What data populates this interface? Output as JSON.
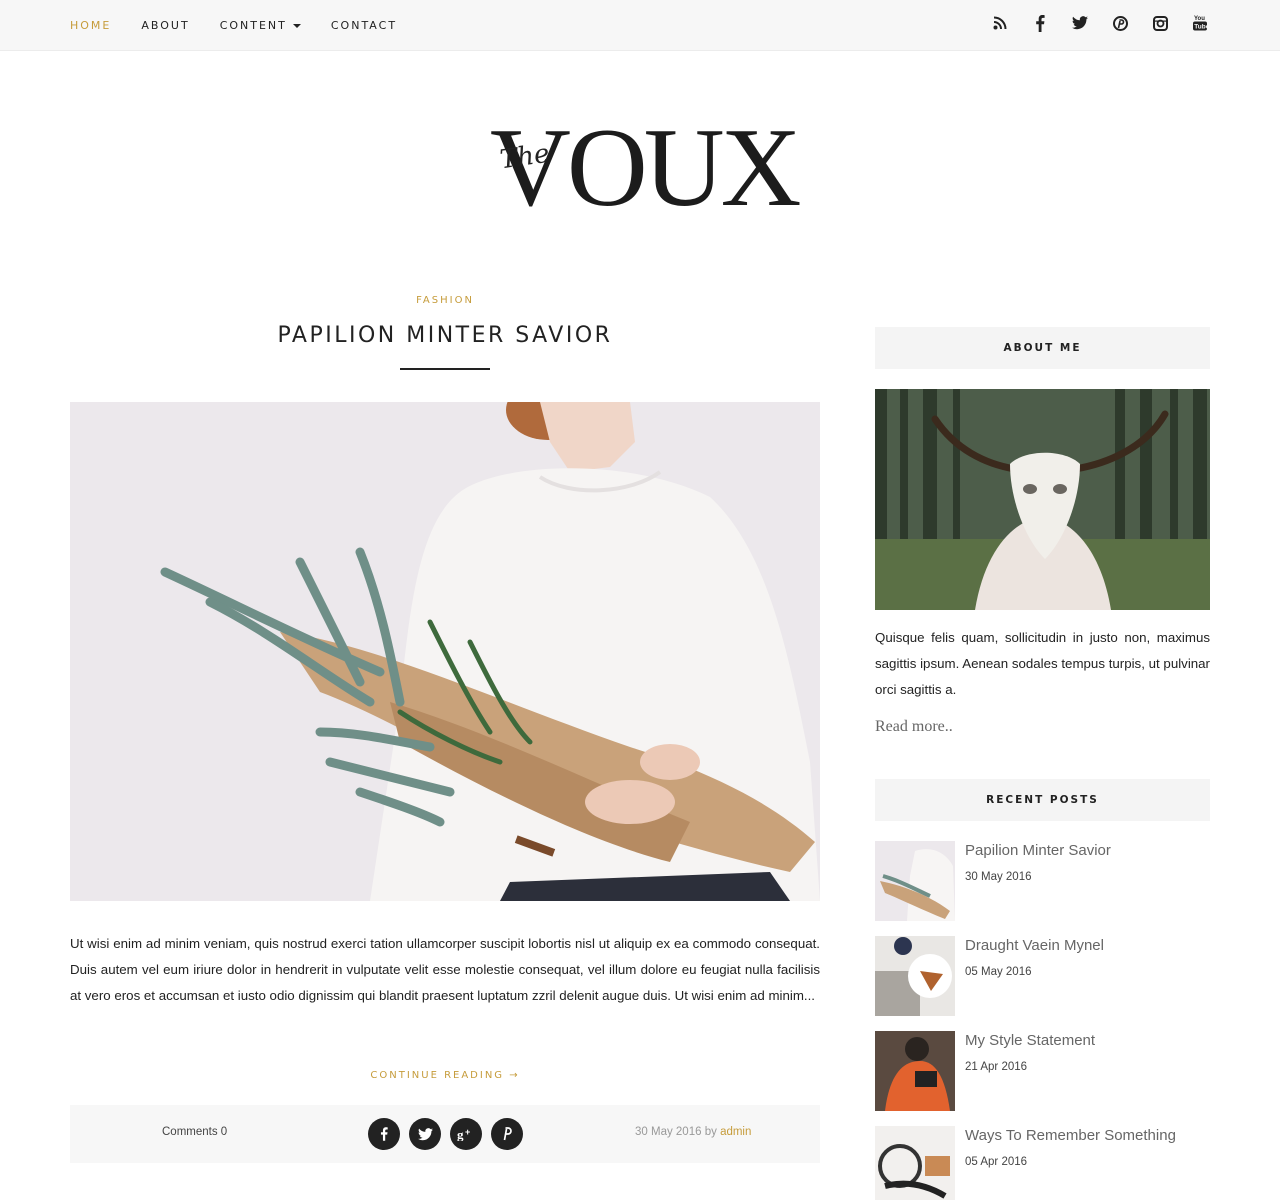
{
  "nav": {
    "items": [
      {
        "label": "HOME",
        "active": true
      },
      {
        "label": "ABOUT",
        "active": false
      },
      {
        "label": "CONTENT",
        "active": false,
        "dropdown": true
      },
      {
        "label": "CONTACT",
        "active": false
      }
    ],
    "social_icons": [
      "rss-icon",
      "facebook-icon",
      "twitter-icon",
      "pinterest-icon",
      "instagram-icon",
      "youtube-icon"
    ]
  },
  "logo": {
    "prefix": "The",
    "name": "VOUX"
  },
  "post": {
    "category": "FASHION",
    "title": "PAPILION MINTER SAVIOR",
    "excerpt": "Ut wisi enim ad minim veniam, quis nostrud exerci tation ullamcorper suscipit lobortis nisl ut aliquip ex ea commodo consequat. Duis autem vel eum iriure dolor in hendrerit in vulputate velit esse molestie consequat, vel illum dolore eu feugiat nulla facilisis at vero eros et accumsan et iusto odio dignissim qui blandit praesent luptatum zzril delenit augue duis. Ut wisi enim ad minim...",
    "continue_label": "CONTINUE READING →",
    "comments_label": "Comments 0",
    "date": "30 May 2016",
    "by": "by",
    "author": "admin",
    "share_icons": [
      "facebook-icon",
      "twitter-icon",
      "google-plus-icon",
      "pinterest-icon"
    ]
  },
  "sidebar": {
    "about": {
      "title": "ABOUT ME",
      "text": "Quisque felis quam, sollicitudin in justo non, maximus sagittis ipsum. Aenean sodales tempus turpis, ut pulvinar orci sagittis a.",
      "read_more": "Read more.."
    },
    "recent": {
      "title": "RECENT POSTS",
      "posts": [
        {
          "title": "Papilion Minter Savior",
          "date": "30 May 2016"
        },
        {
          "title": "Draught Vaein Mynel",
          "date": "05 May 2016"
        },
        {
          "title": "My Style Statement",
          "date": "21 Apr 2016"
        },
        {
          "title": "Ways To Remember Something",
          "date": "05 Apr 2016"
        }
      ]
    }
  },
  "colors": {
    "accent": "#c69c3b",
    "text": "#222222",
    "bar": "#f7f7f7"
  }
}
